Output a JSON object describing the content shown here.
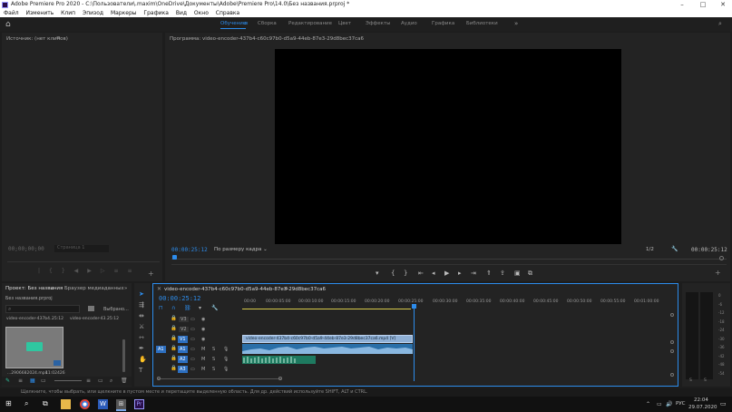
{
  "window": {
    "title": "Adobe Premiere Pro 2020 - C:\\Пользователи\\.maxim\\OneDrive\\Документы\\Adobe\\Premiere Pro\\14.0\\Без названия.prproj *",
    "controls": [
      "–",
      "□",
      "✕"
    ]
  },
  "menu": [
    "Файл",
    "Изменить",
    "Клип",
    "Эпизод",
    "Маркеры",
    "Графика",
    "Вид",
    "Окно",
    "Справка"
  ],
  "workspaces": {
    "tabs": [
      "Обучение",
      "Сборка",
      "Редактирование",
      "Цвет",
      "Эффекты",
      "Аудио",
      "Графика",
      "Библиотеки"
    ],
    "active": "Обучение"
  },
  "source_panel": {
    "title": "Источник: (нет клипов)",
    "timecode": "00;00;00;00",
    "page": "Страница 1"
  },
  "program_panel": {
    "title": "Программа: video-encoder-437b4-c60c97b0-d5a9-44eb-87e3-29d8bec37ca6",
    "timecode_left": "00:00:25:12",
    "fit_label": "По размеру кадра",
    "fraction": "1/2",
    "timecode_right": "00:00:25:12"
  },
  "project_panel": {
    "tabs": [
      "Проект: Без названия",
      "Браузер медиаданных"
    ],
    "file": "Без названия.prproj",
    "search_placeholder": "",
    "selection_label": "Выбрано...",
    "items": [
      {
        "name": "video-encoder-437b4...",
        "duration": "25:12"
      },
      {
        "name": "video-encoder-43...",
        "duration": "25:12"
      }
    ],
    "thumb_name": "...2906682024.mp4",
    "thumb_duration": "11:02426"
  },
  "timeline": {
    "sequence_name": "video-encoder-437b4-c60c97b0-d5a9-44eb-87e3-29d8bec37ca6",
    "timecode": "00:00:25:12",
    "ruler": [
      "00:00",
      "00:00:05:00",
      "00:00:10:00",
      "00:00:15:00",
      "00:00:20:00",
      "00:00:25:00",
      "00:00:30:00",
      "00:00:35:00",
      "00:00:40:00",
      "00:00:45:00",
      "00:00:50:00",
      "00:00:55:00",
      "00:01:00:00"
    ],
    "tracks": [
      {
        "label": "V3",
        "type": "video"
      },
      {
        "label": "V2",
        "type": "video"
      },
      {
        "label": "V1",
        "type": "video"
      },
      {
        "label": "A1",
        "type": "audio",
        "source": "A1"
      },
      {
        "label": "A2",
        "type": "audio"
      },
      {
        "label": "A3",
        "type": "audio"
      }
    ],
    "clip_label": "video-encoder-437b4-c60c97b0-d5a9-44eb-87e3-29d8bec37ca6.mp4 [V]",
    "track_btn_m": "M",
    "track_btn_s": "S",
    "source_patch": "A1"
  },
  "meter": {
    "scale": [
      "0",
      "-6",
      "-12",
      "-18",
      "-24",
      "-30",
      "-36",
      "-42",
      "-48",
      "-54"
    ],
    "bottom": [
      "S",
      "S"
    ]
  },
  "status_bar": {
    "text": "Щелкните, чтобы выбрать, или щелкните в пустом месте и перетащите выделенную область. Для др. действий используйте SHIFT, ALT и CTRL."
  },
  "taskbar": {
    "search_placeholder": "",
    "lang": "РУС",
    "time": "22:04",
    "date": "29.07.2020"
  },
  "colors": {
    "accent": "#2d8ceb",
    "video_clip": "#8fb0d6",
    "audio_clip": "#2a6fa8"
  }
}
